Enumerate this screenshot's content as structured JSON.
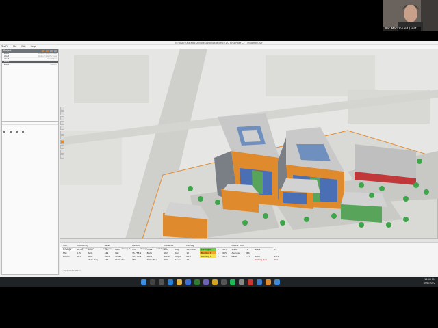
{
  "window": {
    "title": "M:\\Users\\NatMacDonald\\Downloads\\TestV1.0 First Rate CF - modified.tstr"
  },
  "menu": [
    "TestFit",
    "File",
    "Edit",
    "Help"
  ],
  "project_panel": {
    "title": "Project",
    "items": [
      {
        "label": "site 1",
        "right": "Default Site Package"
      },
      {
        "label": "site 2",
        "right": "Default Site Package"
      },
      {
        "label": "site 3",
        "right": "Default Site"
      },
      {
        "label": "site 4",
        "right": ""
      },
      {
        "label": "site 5",
        "right": "Default"
      }
    ]
  },
  "tabs": [
    "tabulation",
    "development",
    "authoring",
    "zoning (1)",
    "storage",
    "parking (1)"
  ],
  "table": {
    "headers": [
      "Site",
      "Multifamily",
      "",
      "Retail",
      "",
      "Garden",
      "",
      "Industrial",
      "",
      "Parking",
      "",
      "Master Plan",
      ""
    ],
    "rows": [
      [
        "Acreage",
        "16.40",
        "Units",
        "31K",
        "Land",
        "157",
        "Units",
        "120",
        "Bldg",
        "31,250.0",
        "Parking A",
        "1",
        "20%",
        "Stalls",
        "79",
        "Stalls",
        "79"
      ],
      [
        "FAR",
        "0.72",
        "Beds",
        "449",
        "Net",
        "35,758.9",
        "Beds",
        "162",
        "Bays",
        "10",
        "Building B",
        "1",
        "60%",
        "Average",
        "364",
        "",
        ""
      ],
      [
        "DU/AC",
        "26.9",
        "Beds",
        "44K.0",
        "Gross",
        "58,758.9",
        "Beds",
        "162.0",
        "Height",
        "84.0",
        "Building C",
        "1",
        "20%",
        "Ratio",
        "1.73",
        "Ratio",
        "1.73"
      ],
      [
        "",
        "",
        "Stalls Req.",
        "477",
        "Stalls Req.",
        "187",
        "Stalls Req.",
        "180",
        "Docks",
        "14",
        "",
        "",
        "",
        "",
        "",
        "Parking Req.",
        "759"
      ]
    ],
    "expand": "expand tabulation"
  },
  "taskbar": {
    "time": "12:40 PM",
    "date": "4/28/2022"
  },
  "webcam": {
    "name": "Nat MacDonald (Test..."
  }
}
